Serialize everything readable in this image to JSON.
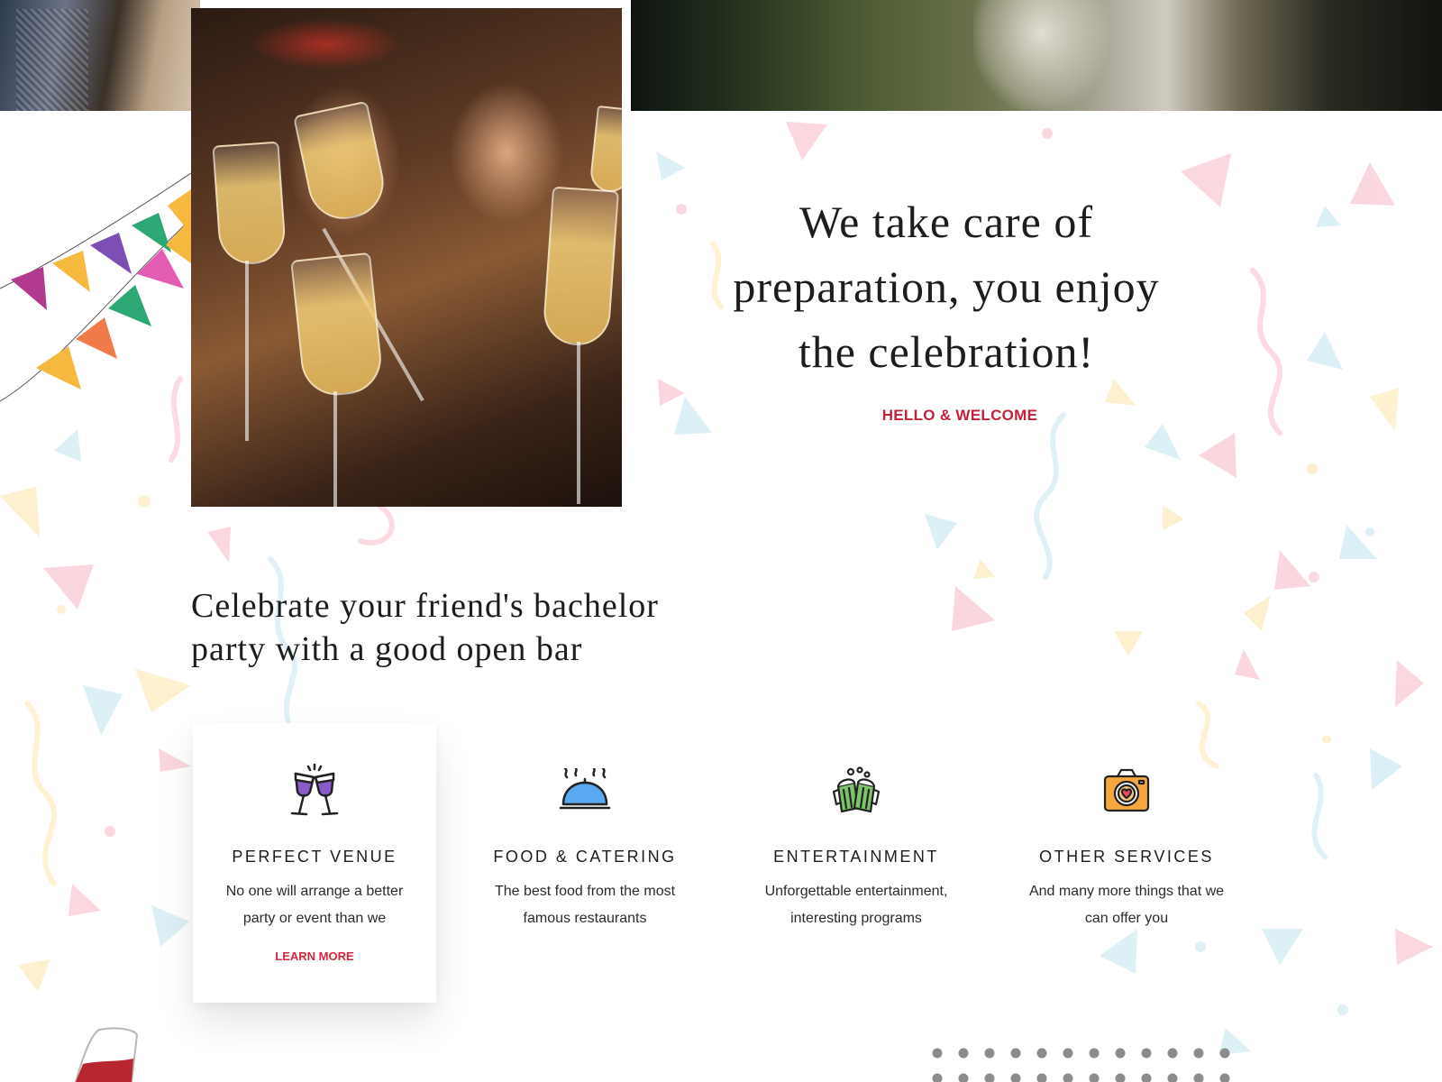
{
  "hero": {
    "heading_line1": "We take care of",
    "heading_line2": "preparation, you enjoy",
    "heading_line3": "the celebration!",
    "tagline": "HELLO & WELCOME"
  },
  "section": {
    "heading_line1": "Celebrate your friend's bachelor",
    "heading_line2": "party with a good open bar"
  },
  "services": [
    {
      "icon": "wine-glasses-icon",
      "title": "PERFECT VENUE",
      "desc_line1": "No one will arrange a better",
      "desc_line2": "party or event than we",
      "link": "LEARN MORE"
    },
    {
      "icon": "food-cloche-icon",
      "title": "FOOD & CATERING",
      "desc_line1": "The best food from the most",
      "desc_line2": "famous restaurants"
    },
    {
      "icon": "beer-mugs-icon",
      "title": "ENTERTAINMENT",
      "desc_line1": "Unforgettable entertainment,",
      "desc_line2": "interesting programs"
    },
    {
      "icon": "camera-heart-icon",
      "title": "OTHER SERVICES",
      "desc_line1": "And many more things that we",
      "desc_line2": "can offer you"
    }
  ],
  "colors": {
    "accent": "#c1223a",
    "link": "#d4283a",
    "text": "#1d1d1d",
    "icon_purple": "#8b5cc9",
    "icon_blue": "#5aa8f0",
    "icon_green": "#7cc36a",
    "icon_orange": "#f4a640"
  }
}
